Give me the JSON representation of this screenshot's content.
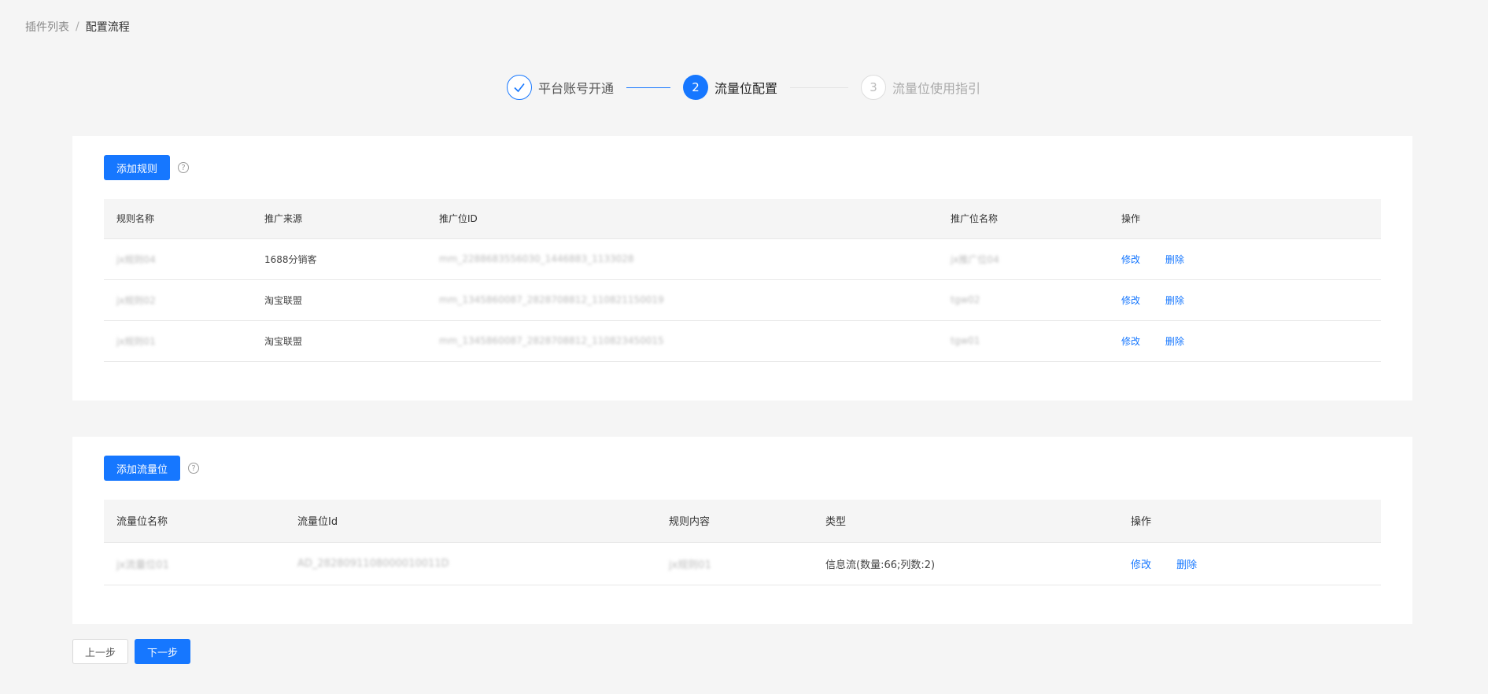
{
  "breadcrumb": {
    "parent": "插件列表",
    "separator": "/",
    "current": "配置流程"
  },
  "steps": [
    {
      "status": "done",
      "index": "✓",
      "label": "平台账号开通"
    },
    {
      "status": "active",
      "index": "2",
      "label": "流量位配置"
    },
    {
      "status": "wait",
      "index": "3",
      "label": "流量位使用指引"
    }
  ],
  "rules": {
    "add_button": "添加规则",
    "help_icon": "?",
    "columns": [
      "规则名称",
      "推广来源",
      "推广位ID",
      "推广位名称",
      "操作"
    ],
    "rows": [
      {
        "name": "jx规则04",
        "source": "1688分销客",
        "id": "mm_2288683556030_1446883_1133028",
        "pos_name": "jx推广位04",
        "edit": "修改",
        "delete": "删除"
      },
      {
        "name": "jx规则02",
        "source": "淘宝联盟",
        "id": "mm_1345860087_2828708812_110821150019",
        "pos_name": "tgw02",
        "edit": "修改",
        "delete": "删除"
      },
      {
        "name": "jx规则01",
        "source": "淘宝联盟",
        "id": "mm_1345860087_2828708812_110823450015",
        "pos_name": "tgw01",
        "edit": "修改",
        "delete": "删除"
      }
    ]
  },
  "slots": {
    "add_button": "添加流量位",
    "help_icon": "?",
    "columns": [
      "流量位名称",
      "流量位Id",
      "规则内容",
      "类型",
      "操作"
    ],
    "rows": [
      {
        "name": "jx流量位01",
        "id": "AD_2828091108000010011D",
        "rule": "jx规则01",
        "type": "信息流(数量:66;列数:2)",
        "edit": "修改",
        "delete": "删除"
      }
    ]
  },
  "footer": {
    "prev": "上一步",
    "next": "下一步"
  },
  "colors": {
    "primary": "#1677ff",
    "background": "#f5f5f5"
  }
}
